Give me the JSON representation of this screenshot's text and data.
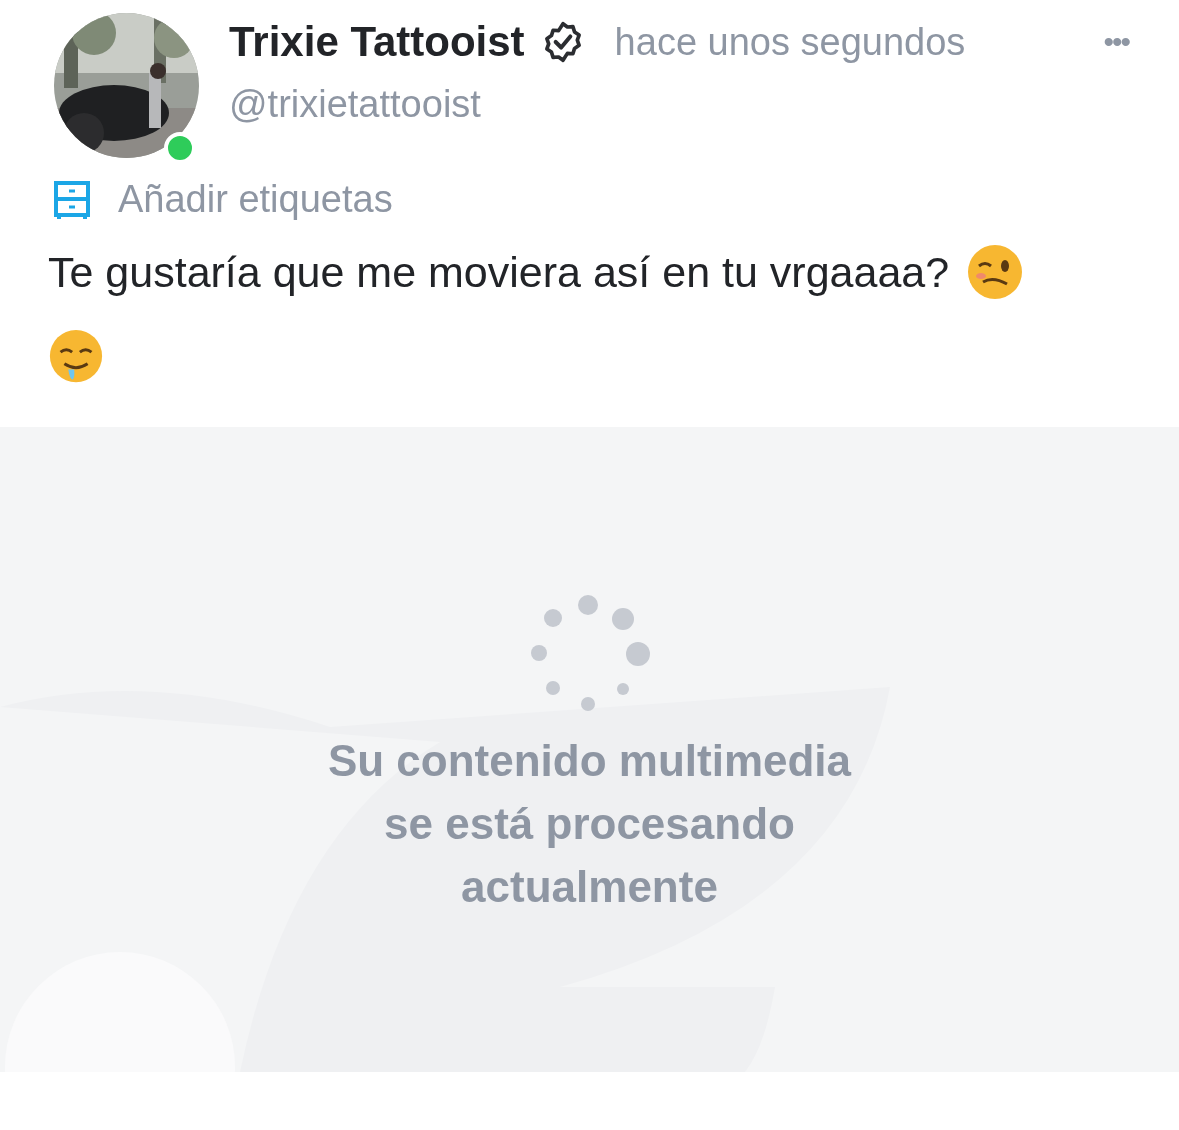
{
  "author": {
    "name": "Trixie Tattooist",
    "verified": true,
    "online": true,
    "handle": "@trixietattooist"
  },
  "time": "hace unos segundos",
  "menu_icon": "•••",
  "tags_link": "Añadir etiquetas",
  "post": {
    "text": "Te gustaría que me moviera así en tu vrgaaaa?",
    "emojis": [
      {
        "kind": "woozy"
      },
      {
        "kind": "drooling"
      }
    ]
  },
  "media": {
    "loading": true,
    "message": "Su contenido multimedia se está procesando actualmente"
  }
}
